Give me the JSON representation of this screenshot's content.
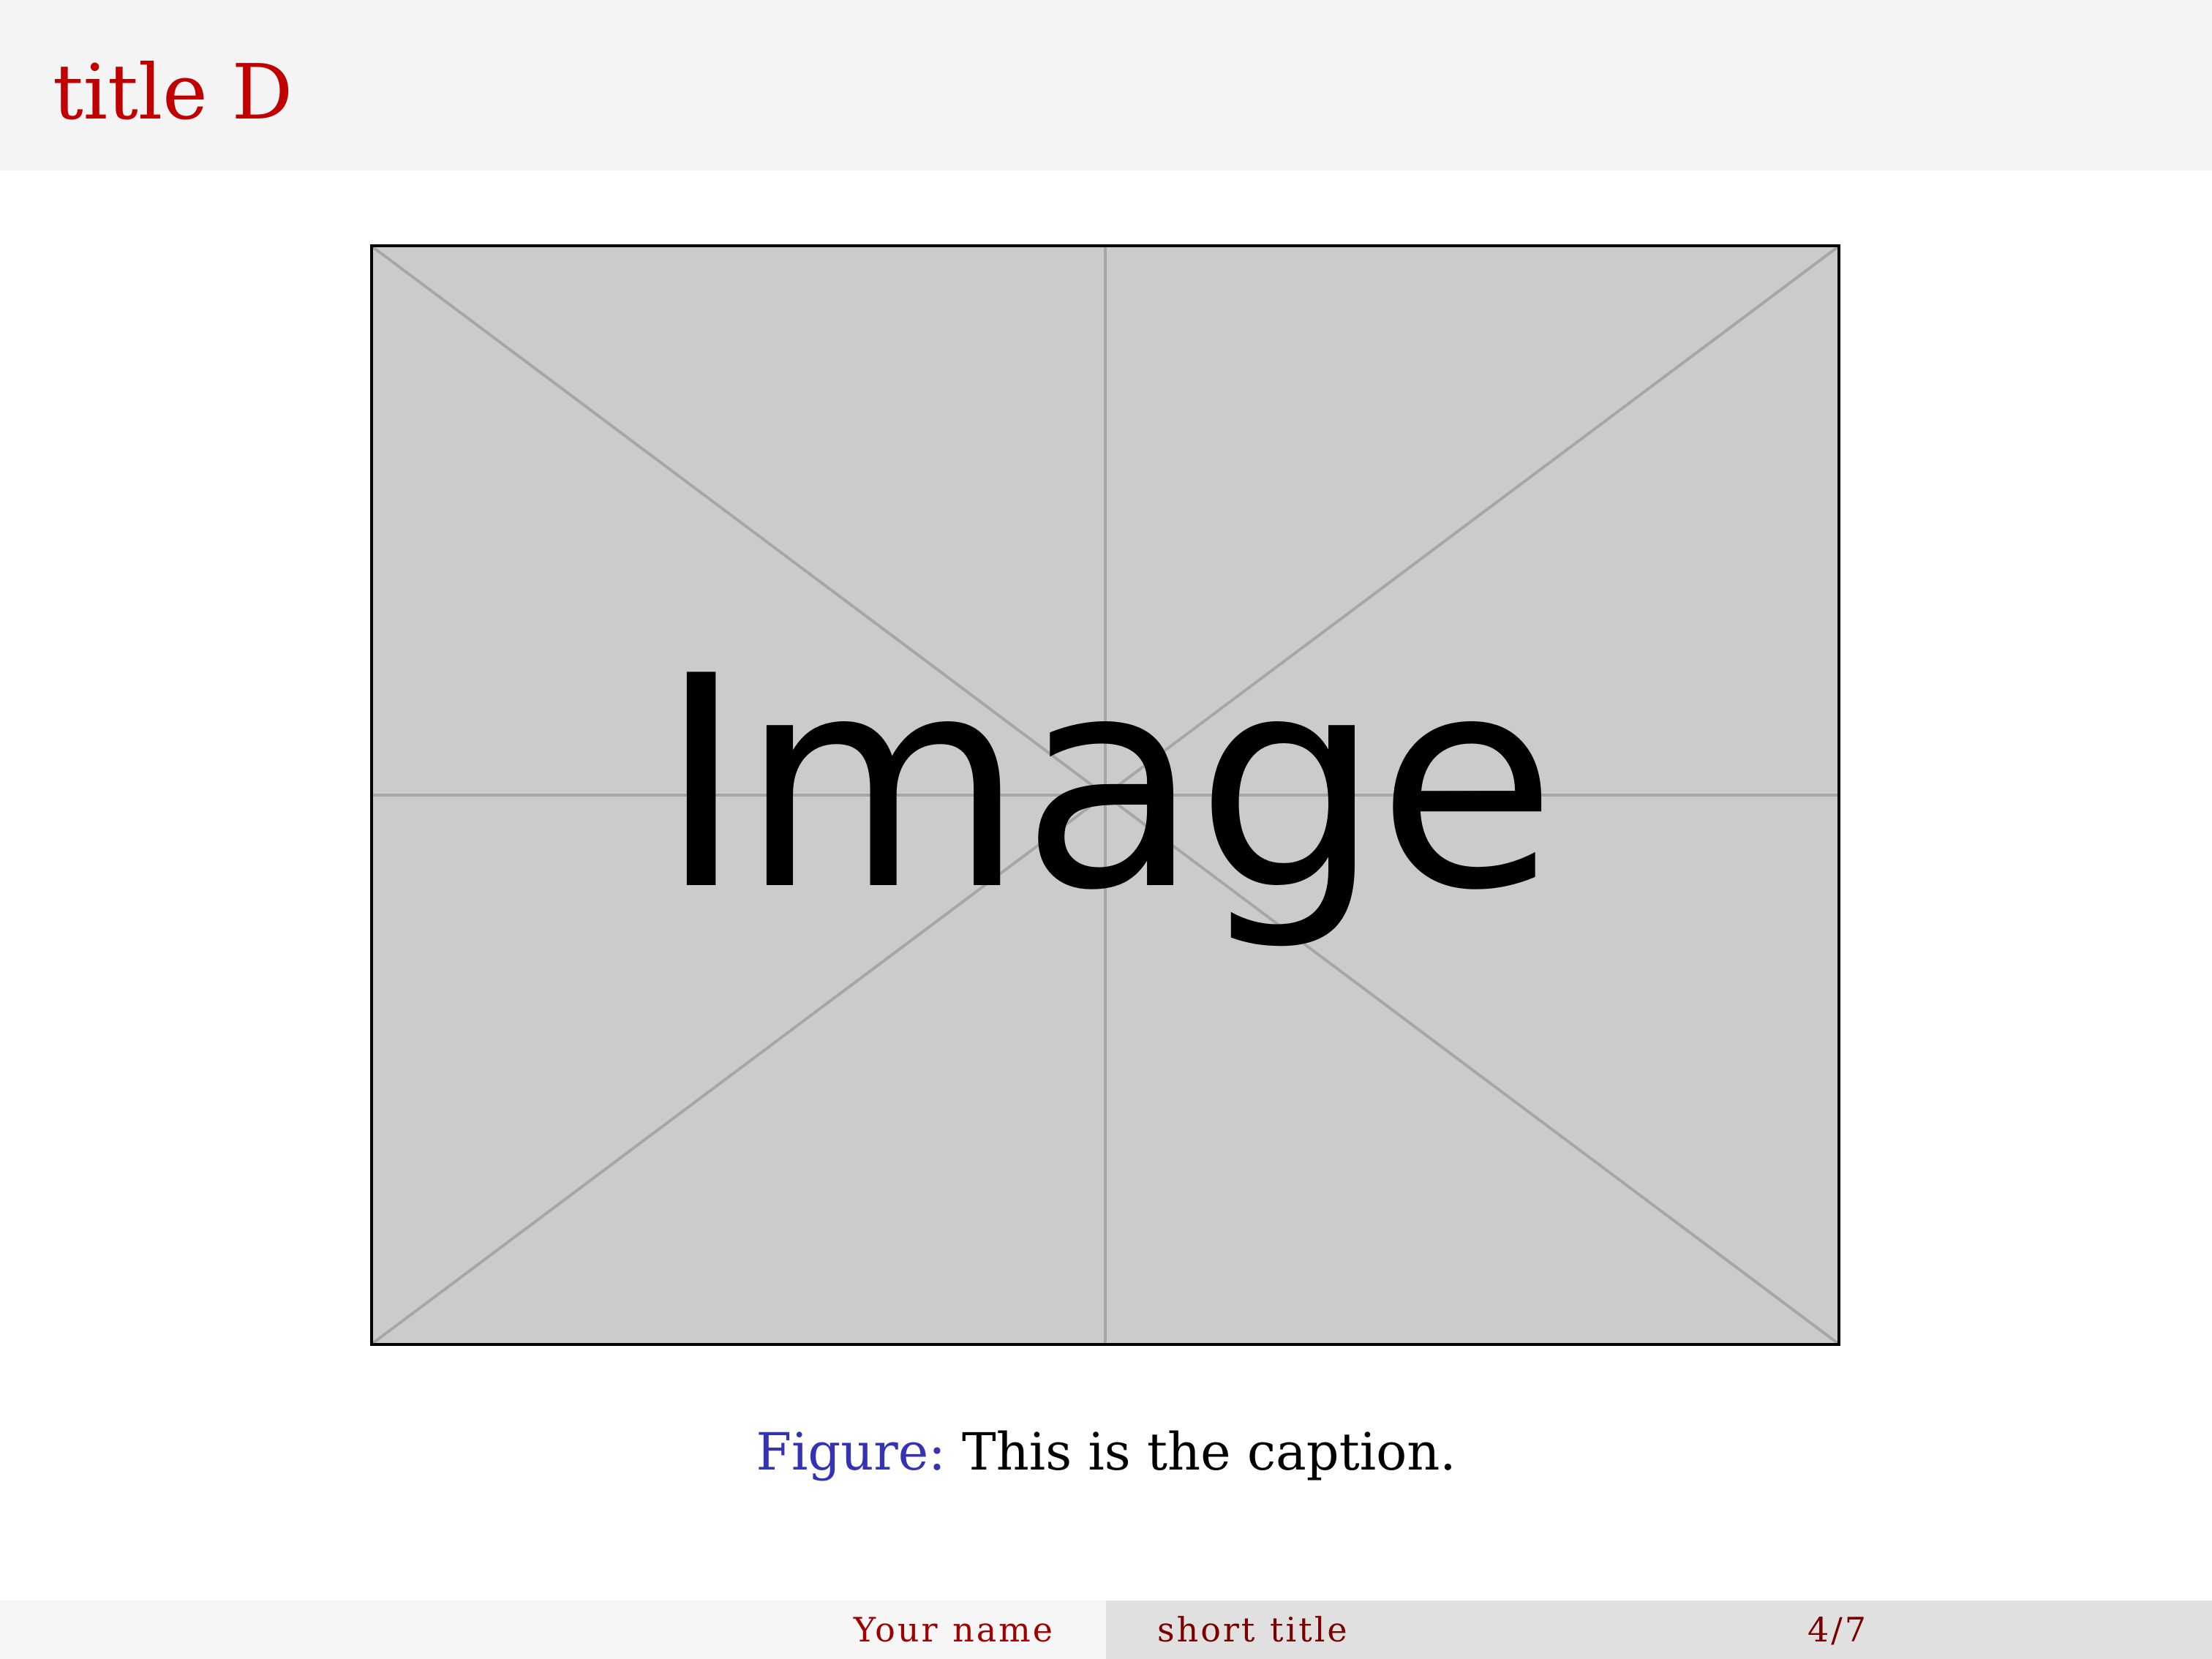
{
  "slide": {
    "title": "title D",
    "title_color": "#c00000"
  },
  "figure": {
    "placeholder_label": "Image",
    "caption_label": "Figure:",
    "caption_text": "This is the caption.",
    "caption_label_color": "#3333b3"
  },
  "footer": {
    "author": "Your name",
    "short_title": "short title",
    "page_number": "4/7"
  }
}
